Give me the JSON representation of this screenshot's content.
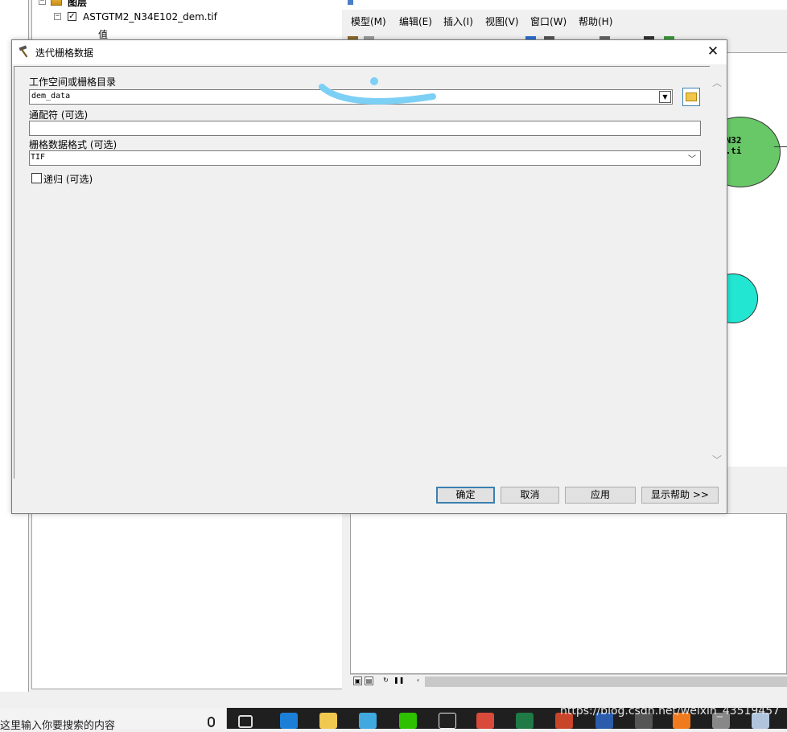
{
  "toc": {
    "group_label": "图层",
    "layer_name": "ASTGTM2_N34E102_dem.tif",
    "value_label": "值"
  },
  "model_builder": {
    "menu": [
      "模型(M)",
      "编辑(E)",
      "插入(I)",
      "视图(V)",
      "窗口(W)",
      "帮助(H)"
    ],
    "element_label": "_N32\nm.ti",
    "element_colors": {
      "data_element": "#68c868",
      "tool_element": "#22e6d2"
    }
  },
  "dialog": {
    "title": "迭代栅格数据",
    "close_symbol": "✕",
    "workspace_label": "工作空间或栅格目录",
    "workspace_value": "dem_data",
    "wildcard_label": "通配符 (可选)",
    "wildcard_value": "",
    "format_label": "栅格数据格式 (可选)",
    "format_value": "TIF",
    "recursive_label": "递归 (可选)",
    "recursive_checked": false,
    "buttons": {
      "ok": "确定",
      "cancel": "取消",
      "apply": "应用",
      "help": "显示帮助 >>"
    }
  },
  "taskbar": {
    "search_placeholder": "这里输入你要搜索的内容",
    "watermark": "https://blog.csdn.net/weixin_43519457"
  },
  "colors": {
    "accent": "#3c7fb1",
    "annotation": "#7dd0f5"
  }
}
